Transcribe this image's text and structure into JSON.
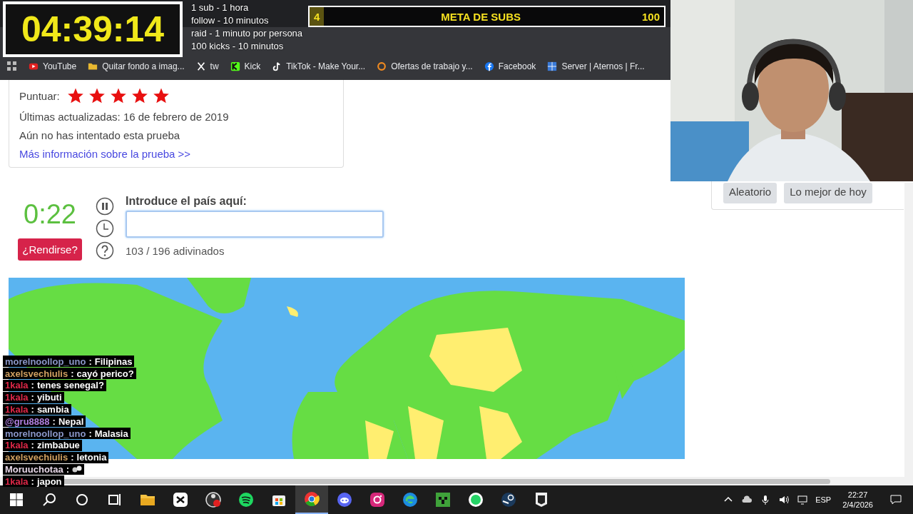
{
  "bookmarks": [
    {
      "kind": "youtube",
      "label": "YouTube"
    },
    {
      "kind": "folder",
      "label": "Quitar fondo a imag..."
    },
    {
      "kind": "x",
      "label": "tw"
    },
    {
      "kind": "kick",
      "label": "Kick"
    },
    {
      "kind": "tiktok",
      "label": "TikTok - Make Your..."
    },
    {
      "kind": "ring",
      "label": "Ofertas de trabajo y..."
    },
    {
      "kind": "facebook",
      "label": "Facebook"
    },
    {
      "kind": "grid",
      "label": "Server | Aternos | Fr..."
    }
  ],
  "stream_timer": "04:39:14",
  "rules": [
    "1 sub - 1 hora",
    "follow - 10 minutos",
    "raid - 1 minuto por persona",
    "100 kicks - 10 minutos"
  ],
  "sub_goal": {
    "current": "4",
    "title": "META DE SUBS",
    "target": "100",
    "level": 0.04
  },
  "quiz_card": {
    "rating_label": "Puntuar:",
    "stars": 5,
    "updated": "Últimas actualizadas: 16 de febrero de 2019",
    "status": "Aún no has intentado esta prueba",
    "more_link": "Más información sobre la prueba >>"
  },
  "side_buttons": [
    "Aleatorio",
    "Lo mejor de hoy"
  ],
  "quiz": {
    "timer": "0:22",
    "give_up": "¿Rendirse?",
    "prompt": "Introduce el país aquí:",
    "progress": "103 / 196 adivinados"
  },
  "chat": [
    {
      "user": "morelnoollop_uno",
      "color": "#8a96c8",
      "sep": ":",
      "message": "Filipinas"
    },
    {
      "user": "axelsvechiulis",
      "color": "#d0a060",
      "sep": ":",
      "message": "cayó perico?"
    },
    {
      "user": "1kala",
      "color": "#e02848",
      "sep": ":",
      "message": "tenes senegal?"
    },
    {
      "user": "1kala",
      "color": "#e02848",
      "sep": ":",
      "message": "yibuti"
    },
    {
      "user": "1kala",
      "color": "#e02848",
      "sep": ":",
      "message": "sambia"
    },
    {
      "user": "@gru8888",
      "color": "#b080e0",
      "sep": ":",
      "message": "Nepal"
    },
    {
      "user": "morelnoollop_uno",
      "color": "#8a96c8",
      "sep": ":",
      "message": "Malasia"
    },
    {
      "user": "1kala",
      "color": "#e02848",
      "sep": ":",
      "message": "zimbabue"
    },
    {
      "user": "axelsvechiulis",
      "color": "#d0a060",
      "sep": ":",
      "message": "letonia"
    },
    {
      "user": "Moruuchotaa",
      "color": "#e8d8e8",
      "sep": ":",
      "kind": "emote"
    },
    {
      "user": "1kala",
      "color": "#e02848",
      "sep": ":",
      "message": "japon"
    }
  ],
  "taskbar": {
    "apps": [
      {
        "kind": "capcut",
        "selected": false
      },
      {
        "kind": "obs",
        "selected": false
      },
      {
        "kind": "spotify",
        "selected": false
      },
      {
        "kind": "store",
        "selected": false
      },
      {
        "kind": "chrome",
        "selected": true
      },
      {
        "kind": "discord",
        "selected": false
      },
      {
        "kind": "instagram",
        "selected": false
      },
      {
        "kind": "edge",
        "selected": false
      },
      {
        "kind": "minecraft",
        "selected": false
      },
      {
        "kind": "whatsapp",
        "selected": false
      },
      {
        "kind": "steam",
        "selected": false
      },
      {
        "kind": "epic",
        "selected": false
      }
    ],
    "language": "ESP",
    "time": "22:27",
    "date": "2/4/2026"
  }
}
